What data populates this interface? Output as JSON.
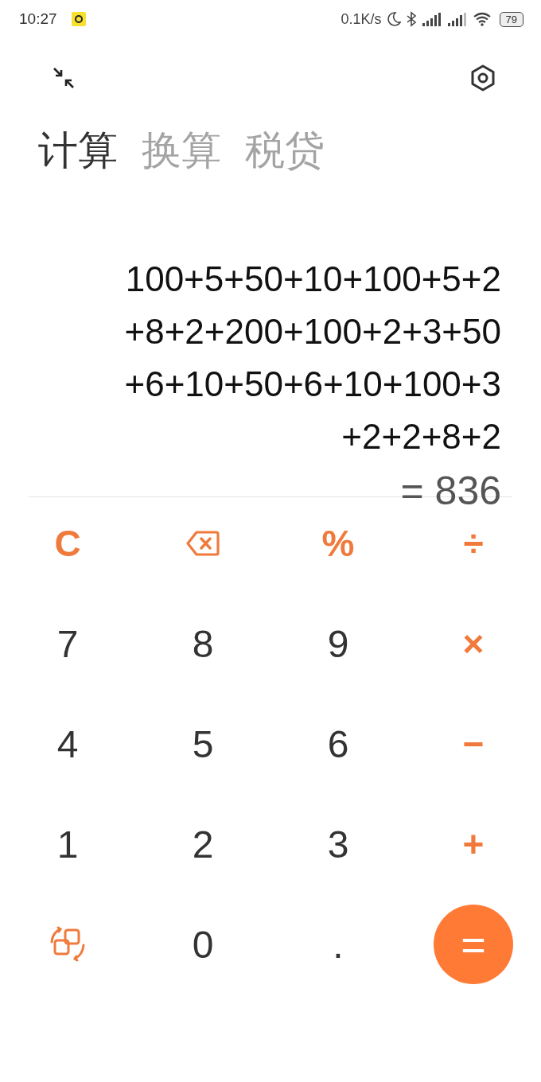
{
  "status_bar": {
    "time": "10:27",
    "speed": "0.1K/s",
    "battery": "79"
  },
  "tabs": [
    {
      "label": "计算",
      "selected": true
    },
    {
      "label": "换算",
      "selected": false
    },
    {
      "label": "税贷",
      "selected": false
    }
  ],
  "display": {
    "expression_lines": [
      "100+5+50+10+100+5+2",
      "+8+2+200+100+2+3+50",
      "+6+10+50+6+10+100+3",
      "+2+2+8+2"
    ],
    "result": "= 836"
  },
  "keys": [
    {
      "kind": "operator",
      "label": "C"
    },
    {
      "kind": "backspace"
    },
    {
      "kind": "operator",
      "label": "%"
    },
    {
      "kind": "operator",
      "label": "÷"
    },
    {
      "kind": "digit",
      "label": "7"
    },
    {
      "kind": "digit",
      "label": "8"
    },
    {
      "kind": "digit",
      "label": "9"
    },
    {
      "kind": "operator",
      "label": "×"
    },
    {
      "kind": "digit",
      "label": "4"
    },
    {
      "kind": "digit",
      "label": "5"
    },
    {
      "kind": "digit",
      "label": "6"
    },
    {
      "kind": "operator",
      "label": "−"
    },
    {
      "kind": "digit",
      "label": "1"
    },
    {
      "kind": "digit",
      "label": "2"
    },
    {
      "kind": "digit",
      "label": "3"
    },
    {
      "kind": "operator",
      "label": "+"
    },
    {
      "kind": "switch"
    },
    {
      "kind": "digit",
      "label": "0"
    },
    {
      "kind": "digit",
      "label": "."
    },
    {
      "kind": "equals",
      "label": "="
    }
  ]
}
